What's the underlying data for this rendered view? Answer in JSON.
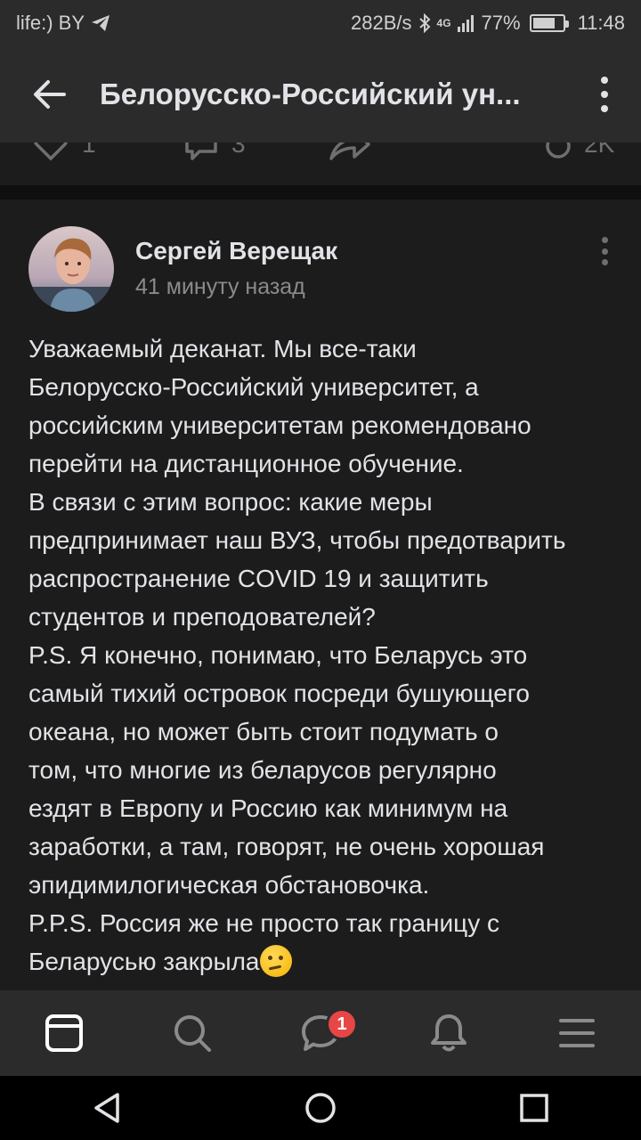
{
  "status_bar": {
    "carrier": "life:) BY",
    "speed": "282B/s",
    "network": "4G",
    "battery_percent": "77%",
    "battery_level": 0.77,
    "time": "11:48"
  },
  "header": {
    "title": "Белорусско-Российский ун...",
    "back_icon": "arrow-left-icon",
    "menu_icon": "more-vertical-icon"
  },
  "prev_post": {
    "likes": "1",
    "comments": "3",
    "views": "2K"
  },
  "post": {
    "author": "Сергей Верещак",
    "time": "41 минуту назад",
    "lines": [
      "Уважаемый деканат. Мы все-таки",
      "Белорусско-Российский университет, а",
      "российским университетам рекомендовано",
      "перейти на дистанционное обучение.",
      "В связи с этим вопрос: какие меры",
      "предпринимает наш ВУЗ, чтобы предотварить",
      "распространение COVID 19 и защитить",
      "студентов и преподователей?",
      "P.S. Я конечно, понимаю, что Беларусь это",
      "самый тихий островок посреди бушующего",
      "океана, но может быть стоит подумать о",
      "том, что многие из беларусов регулярно",
      "ездят в Европу и Россию как минимум на",
      "заработки, а там, говорят, не очень хорошая",
      "эпидимилогическая обстановочка.",
      "P.P.S. Россия же не просто так границу с",
      "Беларусью закрыла"
    ],
    "emoji_icon": "thinking-face-icon"
  },
  "tab_bar": {
    "messages_badge": "1",
    "tabs": [
      "news-icon",
      "search-icon",
      "messages-icon",
      "notifications-icon",
      "menu-icon"
    ]
  },
  "colors": {
    "background": "#191919",
    "surface": "#2b2b2c",
    "card": "#1c1c1d",
    "text": "#e1e3e6",
    "secondary_text": "#8a8b8d",
    "badge": "#e64646"
  }
}
